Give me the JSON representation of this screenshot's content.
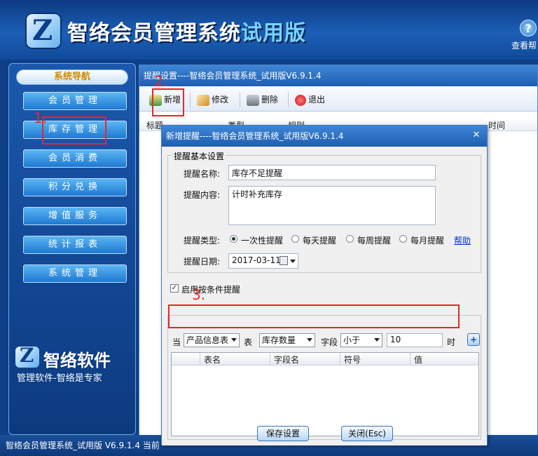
{
  "banner": {
    "title_main": "智络会员管理系统",
    "title_trial": "试用版",
    "help_label": "查看帮"
  },
  "sidebar": {
    "header": "系统导航",
    "items": [
      {
        "label": "会员管理"
      },
      {
        "label": "库存管理"
      },
      {
        "label": "会员消费"
      },
      {
        "label": "积分兑换"
      },
      {
        "label": "增值服务"
      },
      {
        "label": "统计报表"
      },
      {
        "label": "系统管理"
      }
    ],
    "brand_name": "智络软件",
    "brand_slogan": "管理软件-智络是专家"
  },
  "bg_window": {
    "title": "提醒设置----智络会员管理系统_试用版V6.9.1.4",
    "toolbar": {
      "add": "新增",
      "edit": "修改",
      "delete": "删除",
      "exit": "退出"
    },
    "columns": [
      "标题",
      "类型",
      "规则",
      "时间"
    ]
  },
  "status_bar": {
    "text": "智络会员管理系统_试用版 V6.9.1.4 当前"
  },
  "dialog": {
    "title": "新增提醒----智络会员管理系统_试用版V6.9.1.4",
    "group_basic": "提醒基本设置",
    "name_label": "提醒名称:",
    "name_value": "库存不足提醒",
    "content_label": "提醒内容:",
    "content_value": "计时补充库存",
    "type_label": "提醒类型:",
    "type_options": [
      "一次性提醒",
      "每天提醒",
      "每周提醒",
      "每月提醒"
    ],
    "help_link": "帮助",
    "date_label": "提醒日期:",
    "date_value": "2017-03-11",
    "enable_label": "启用按条件提醒",
    "cond": {
      "prefix": "当",
      "table_value": "产品信息表",
      "table_label": "表",
      "field_value": "库存数量",
      "field_label": "字段",
      "op_value": "小于",
      "num_value": "10",
      "suffix": "时",
      "add": "+"
    },
    "cond_columns": [
      "表名",
      "字段名",
      "符号",
      "值"
    ],
    "save_button": "保存设置",
    "close_button": "关闭(Esc)"
  },
  "annotations": {
    "one": "1.",
    "two": "2.",
    "three": "3."
  },
  "colors": {
    "annotation": "#e8262b",
    "title_bar": "#1f5eb1",
    "sidebar": "#1b58ad"
  }
}
